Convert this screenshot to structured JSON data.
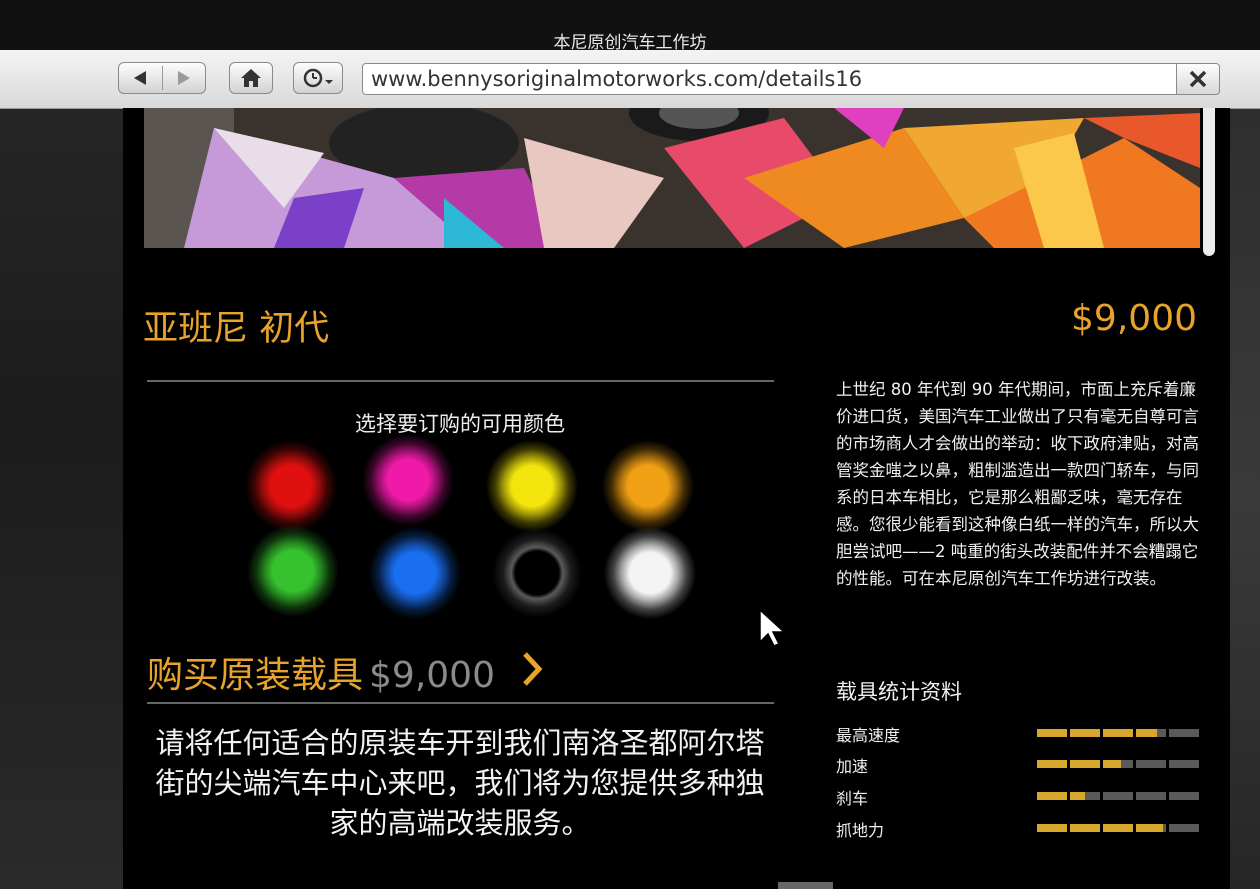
{
  "window": {
    "title": "本尼原创汽车工作坊"
  },
  "browser": {
    "url": "www.bennysoriginalmotorworks.com/details16"
  },
  "vehicle": {
    "name": "亚班尼 初代",
    "price": "$9,000"
  },
  "colors": {
    "title": "选择要订购的可用颜色",
    "options": [
      {
        "name": "red",
        "hex": "#e01010"
      },
      {
        "name": "magenta",
        "hex": "#ef1aa8"
      },
      {
        "name": "yellow",
        "hex": "#f2e40c"
      },
      {
        "name": "orange",
        "hex": "#f0a014"
      },
      {
        "name": "green",
        "hex": "#36c22e"
      },
      {
        "name": "blue",
        "hex": "#1a6ef0"
      },
      {
        "name": "black",
        "hex": "#050505"
      },
      {
        "name": "white",
        "hex": "#f4f4f4"
      }
    ]
  },
  "buy": {
    "label": "购买原装载具",
    "price": "$9,000"
  },
  "instructions": "请将任何适合的原装车开到我们南洛圣都阿尔塔街的尖端汽车中心来吧，我们将为您提供多种独家的高端改装服务。",
  "about": "上世纪 80 年代到 90 年代期间，市面上充斥着廉价进口货，美国汽车工业做出了只有毫无自尊可言的市场商人才会做出的举动：收下政府津贴，对高管奖金嗤之以鼻，粗制滥造出一款四门轿车，与同系的日本车相比，它是那么粗鄙乏味，毫无存在感。您很少能看到这种像白纸一样的汽车，所以大胆尝试吧——2 吨重的街头改装配件并不会糟蹋它的性能。可在本尼原创汽车工作坊进行改装。",
  "stats": {
    "title": "载具统计资料",
    "items": [
      {
        "label": "最高速度",
        "value": 0.74
      },
      {
        "label": "加速",
        "value": 0.52
      },
      {
        "label": "刹车",
        "value": 0.3
      },
      {
        "label": "抓地力",
        "value": 0.78
      }
    ]
  },
  "theme": {
    "accent": "#e7a32a",
    "bar_fill": "#d8a72e"
  }
}
